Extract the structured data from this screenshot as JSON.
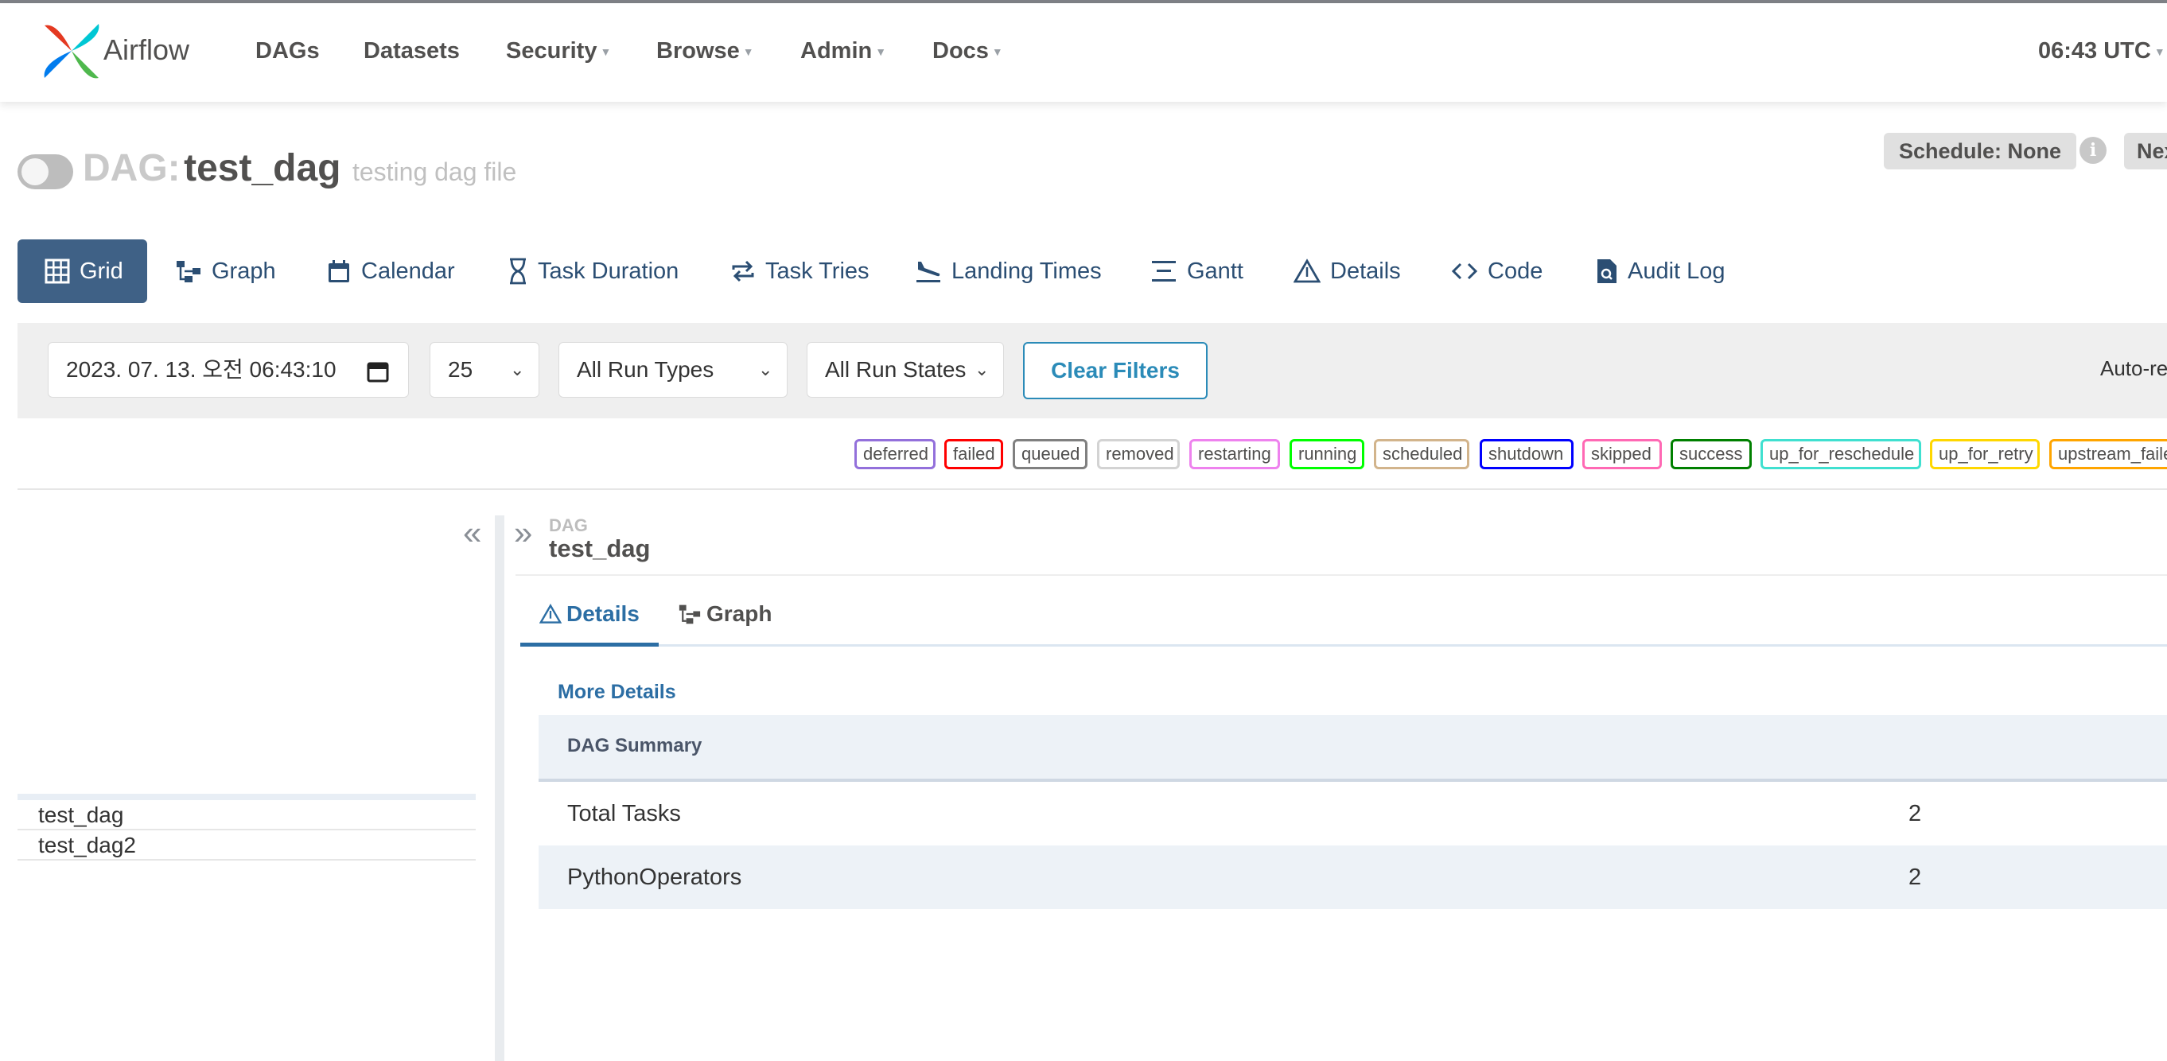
{
  "navbar": {
    "brand": "Airflow",
    "items": [
      {
        "label": "DAGs"
      },
      {
        "label": "Datasets"
      },
      {
        "label": "Security"
      },
      {
        "label": "Browse"
      },
      {
        "label": "Admin"
      },
      {
        "label": "Docs"
      }
    ],
    "clock": "06:43 UTC"
  },
  "dag_header": {
    "prefix": "DAG:",
    "name": "test_dag",
    "description": "testing dag file",
    "schedule_badge": "Schedule: None",
    "next_badge": "Next"
  },
  "tabs": [
    {
      "label": "Grid"
    },
    {
      "label": "Graph"
    },
    {
      "label": "Calendar"
    },
    {
      "label": "Task Duration"
    },
    {
      "label": "Task Tries"
    },
    {
      "label": "Landing Times"
    },
    {
      "label": "Gantt"
    },
    {
      "label": "Details"
    },
    {
      "label": "Code"
    },
    {
      "label": "Audit Log"
    }
  ],
  "filters": {
    "datetime": "2023. 07. 13. 오전 06:43:10",
    "num_runs": "25",
    "run_types": "All Run Types",
    "run_states": "All Run States",
    "clear_label": "Clear Filters",
    "auto_refresh": "Auto-refresh"
  },
  "legend": [
    {
      "label": "deferred",
      "color": "#9370db"
    },
    {
      "label": "failed",
      "color": "#ff0000"
    },
    {
      "label": "queued",
      "color": "#808080"
    },
    {
      "label": "removed",
      "color": "#d3d3d3"
    },
    {
      "label": "restarting",
      "color": "#ee82ee"
    },
    {
      "label": "running",
      "color": "#00ff00"
    },
    {
      "label": "scheduled",
      "color": "#d2b48c"
    },
    {
      "label": "shutdown",
      "color": "#0000ff"
    },
    {
      "label": "skipped",
      "color": "#ff69b4"
    },
    {
      "label": "success",
      "color": "#008000"
    },
    {
      "label": "up_for_reschedule",
      "color": "#40e0d0"
    },
    {
      "label": "up_for_retry",
      "color": "#ffd700"
    },
    {
      "label": "upstream_failed",
      "color": "#ffa500"
    }
  ],
  "tree": {
    "rows": [
      {
        "label": "test_dag"
      },
      {
        "label": "test_dag2"
      }
    ]
  },
  "details_panel": {
    "dag_label": "DAG",
    "dag_name": "test_dag",
    "subtabs": [
      {
        "label": "Details"
      },
      {
        "label": "Graph"
      }
    ],
    "more_details": "More Details",
    "summary_header": "DAG Summary",
    "summary_rows": [
      {
        "label": "Total Tasks",
        "value": "2"
      },
      {
        "label": "PythonOperators",
        "value": "2"
      }
    ]
  }
}
